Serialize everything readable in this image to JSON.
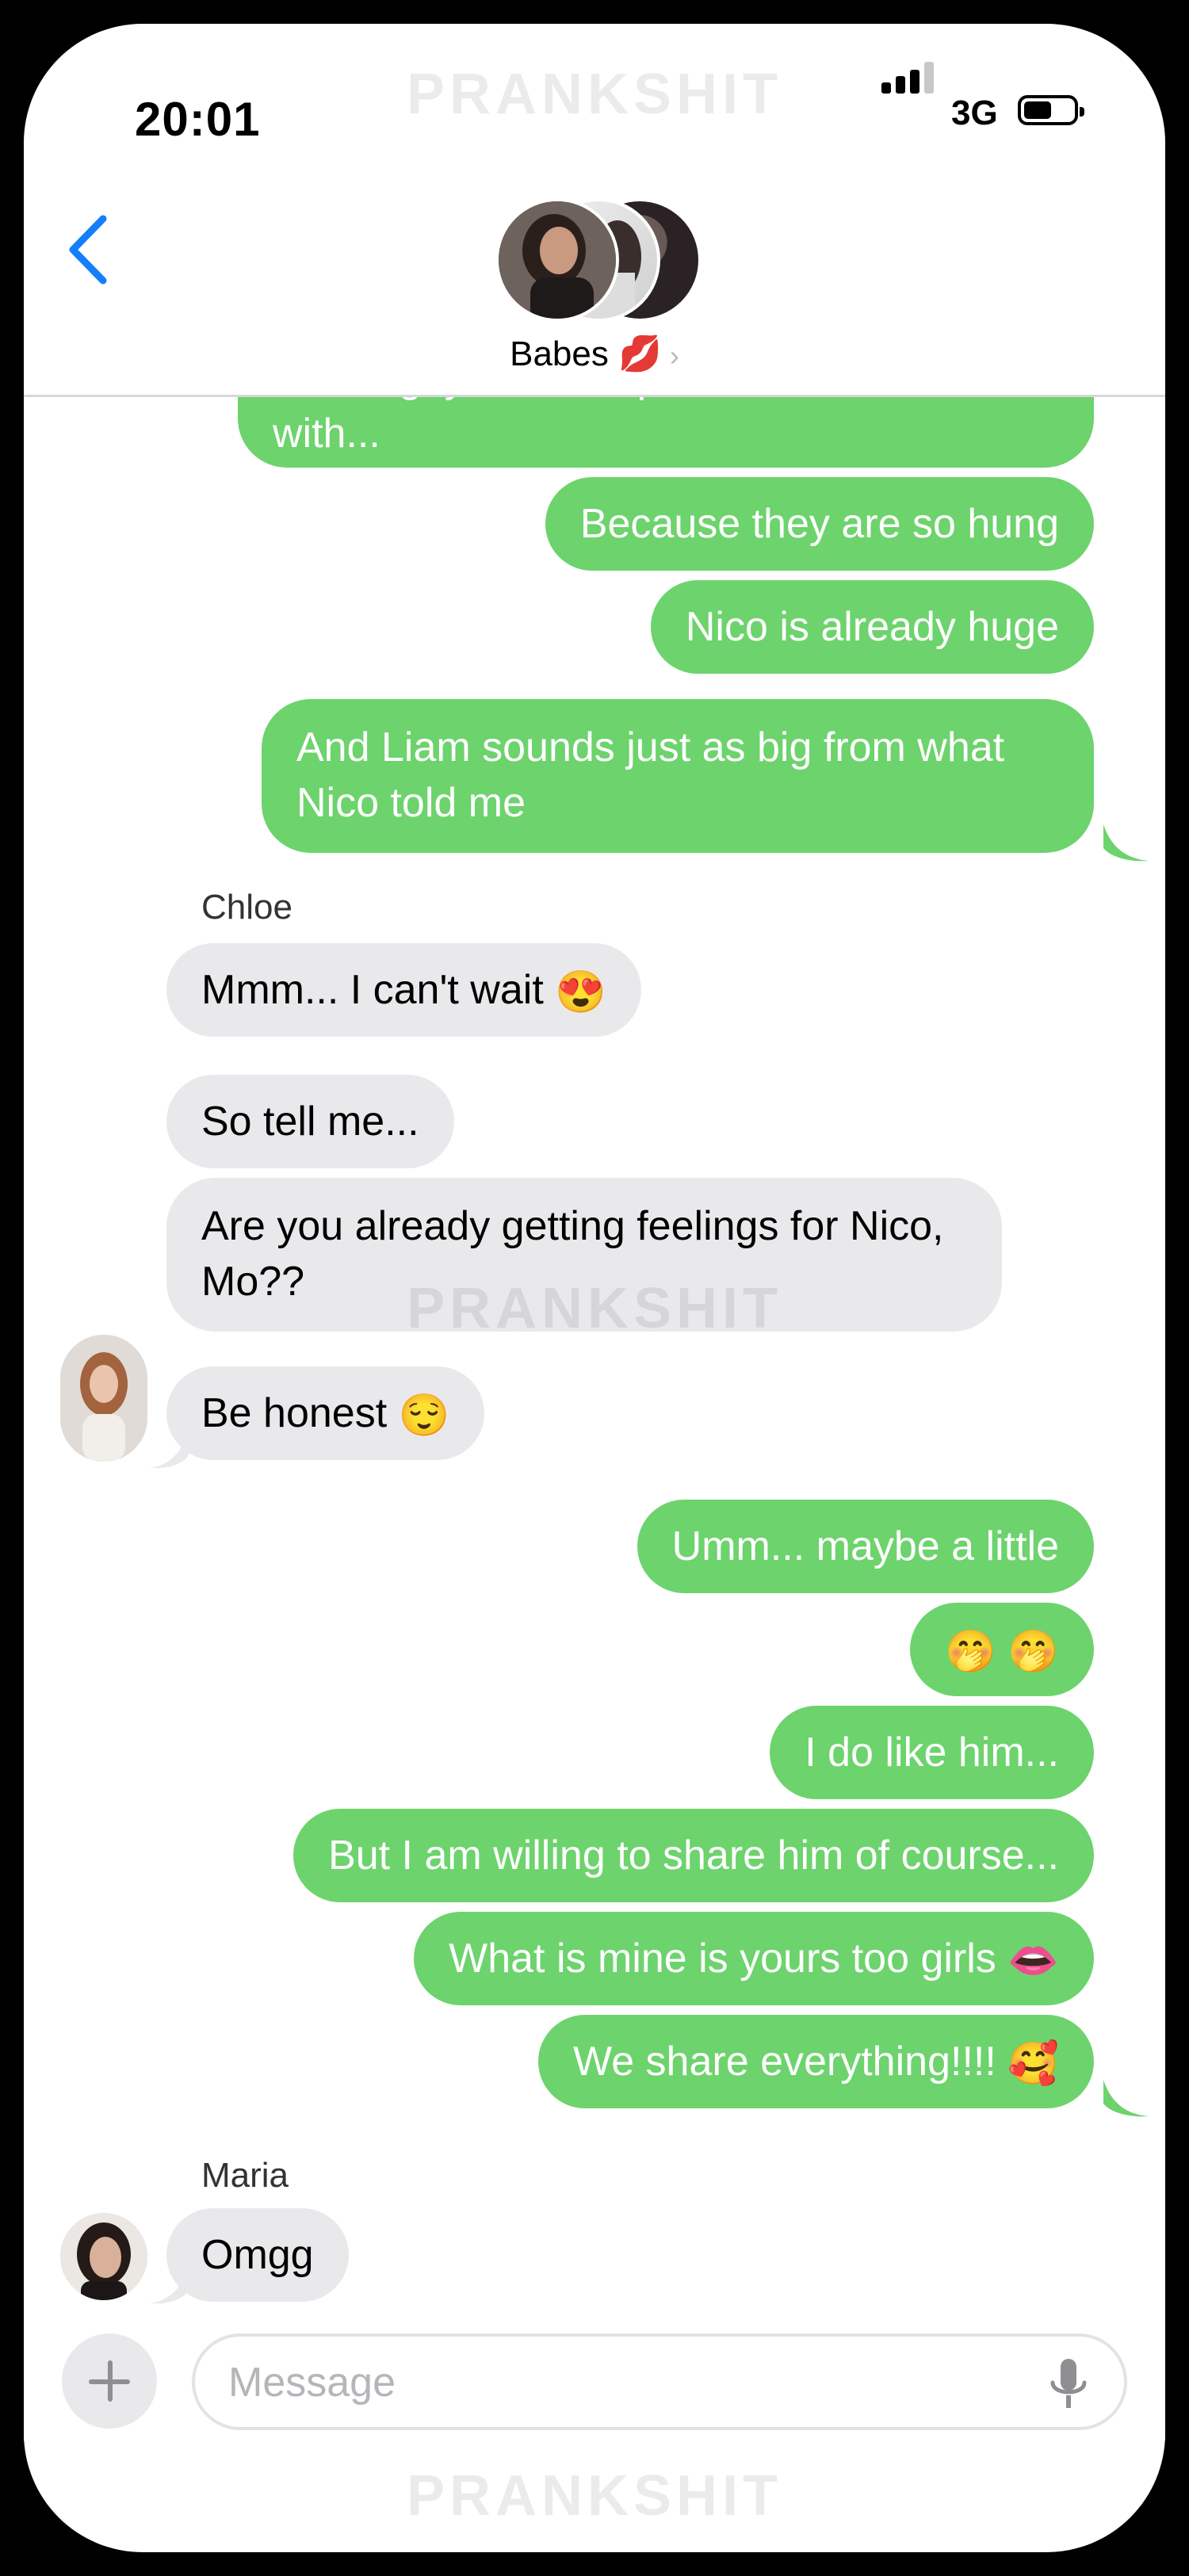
{
  "status_bar": {
    "time": "20:01",
    "network": "3G"
  },
  "header": {
    "group_name": "Babes",
    "group_emoji": "💋"
  },
  "watermark": "PRANKSHIT",
  "messages": [
    {
      "from": "me",
      "lines": [
        "Those guys are the perfect ones to do it",
        "with..."
      ]
    },
    {
      "from": "me",
      "lines": [
        "Because they are so hung"
      ]
    },
    {
      "from": "me",
      "lines": [
        "Nico is already huge"
      ]
    },
    {
      "from": "me",
      "lines": [
        "And Liam sounds just as big from what",
        "Nico told me"
      ]
    },
    {
      "from": "Chloe",
      "sender_label": "Chloe",
      "lines": [
        "Mmm... I can't wait"
      ],
      "emoji": "😍"
    },
    {
      "from": "Chloe",
      "lines": [
        "So tell me..."
      ]
    },
    {
      "from": "Chloe",
      "lines": [
        "Are you already getting feelings for Nico,",
        "Mo??"
      ]
    },
    {
      "from": "Chloe",
      "lines": [
        "Be honest"
      ],
      "emoji": "😌"
    },
    {
      "from": "me",
      "lines": [
        "Umm... maybe a little"
      ]
    },
    {
      "from": "me",
      "lines": [
        ""
      ],
      "emoji": "🤭 🤭"
    },
    {
      "from": "me",
      "lines": [
        "I do like him..."
      ]
    },
    {
      "from": "me",
      "lines": [
        "But I am willing to share him of course..."
      ]
    },
    {
      "from": "me",
      "lines": [
        "What is mine is yours too girls"
      ],
      "emoji": "👄"
    },
    {
      "from": "me",
      "lines": [
        "We share everything!!!!"
      ],
      "emoji": "🥰"
    },
    {
      "from": "Maria",
      "sender_label": "Maria",
      "lines": [
        "Omgg"
      ]
    }
  ],
  "compose": {
    "placeholder": "Message"
  },
  "colors": {
    "outgoing": "#6dd36d",
    "incoming": "#e9e9eb",
    "accent": "#147efb"
  },
  "icons": {
    "back": "chevron-left-icon",
    "add": "plus-icon",
    "mic": "microphone-icon"
  }
}
